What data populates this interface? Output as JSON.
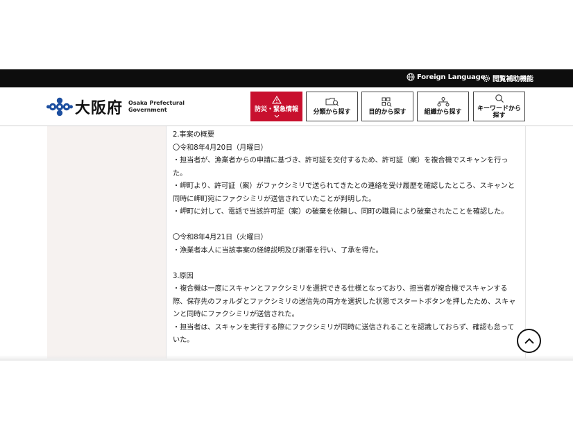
{
  "topbar": {
    "foreign_language": "Foreign Language",
    "accessibility": "閲覧補助機能"
  },
  "logo": {
    "jp": "大阪府",
    "en_line1": "Osaka Prefectural",
    "en_line2": "Government"
  },
  "nav": {
    "emergency": "防災・緊急情報",
    "by_category": "分類から探す",
    "by_purpose": "目的から探す",
    "by_organization": "組織から探す",
    "by_keyword_line1": "キーワードから",
    "by_keyword_line2": "探す"
  },
  "colors": {
    "topbar": "#0d0d0d",
    "emergency": "#c8102e",
    "logo_blue": "#1d4fa0",
    "side_panel": "#f6f2f0"
  },
  "content": {
    "heading2": "2.事案の概要",
    "date1": "〇令和8年4月20日（月曜日）",
    "p1": "・担当者が、漁業者からの申請に基づき、許可証を交付するため、許可証（案）を複合機でスキャンを行った。",
    "p2": "・岬町より、許可証（案）がファクシミリで送られてきたとの連絡を受け履歴を確認したところ、スキャンと同時に岬町宛にファクシミリが送信されていたことが判明した。",
    "p3": "・岬町に対して、電話で当該許可証（案）の破棄を依頼し、同町の職員により破棄されたことを確認した。",
    "date2": "〇令和8年4月21日（火曜日）",
    "p4": "・漁業者本人に当該事案の経緯説明及び謝罪を行い、了承を得た。",
    "heading3": "3.原因",
    "p5": "・複合機は一度にスキャンとファクシミリを選択できる仕様となっており、担当者が複合機でスキャンする際、保存先のフォルダとファクシミリの送信先の両方を選択した状態でスタートボタンを押したため、スキャンと同時にファクシミリが送信された。",
    "p6": "・担当者は、スキャンを実行する際にファクシミリが同時に送信されることを認識しておらず、確認も怠っていた。"
  }
}
